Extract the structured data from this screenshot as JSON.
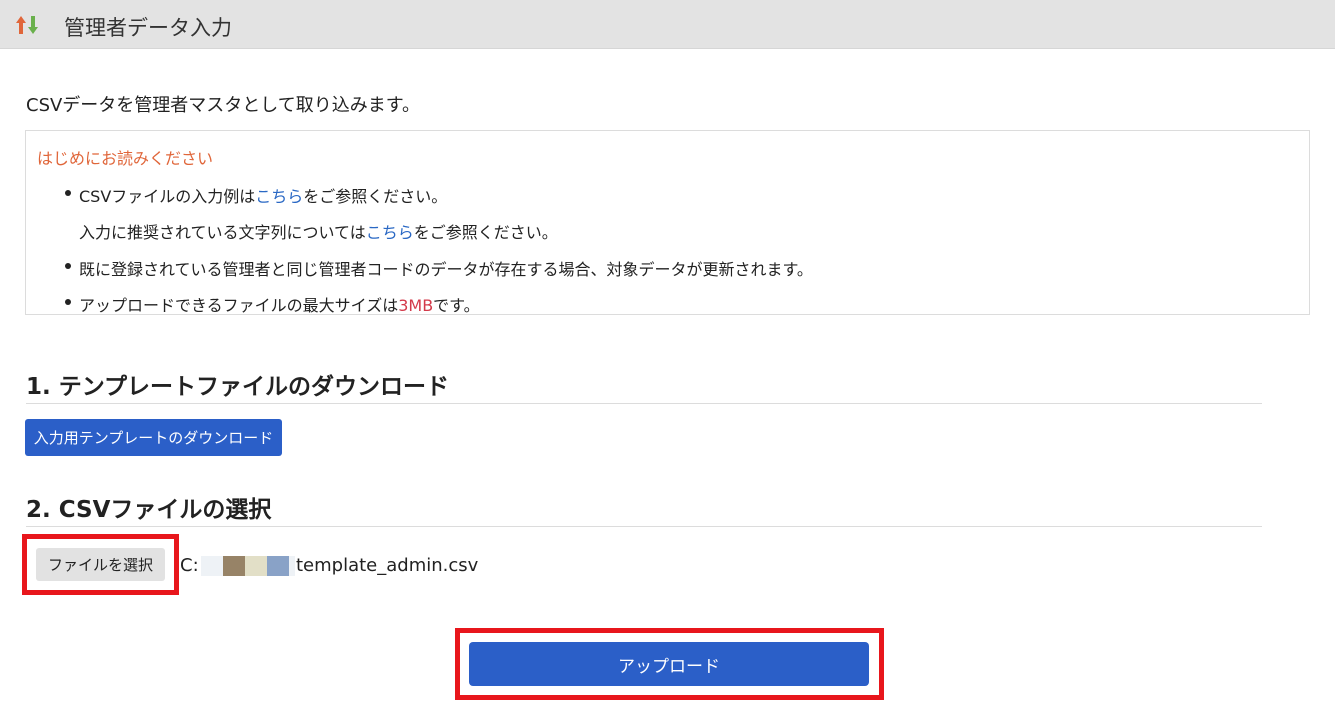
{
  "header": {
    "title": "管理者データ入力",
    "icon": "sort-arrows-icon"
  },
  "intro": "CSVデータを管理者マスタとして取り込みます。",
  "notice": {
    "title": "はじめにお読みください",
    "item1_pre": "CSVファイルの入力例は",
    "item1_link": "こちら",
    "item1_post": "をご参照ください。",
    "item1b_pre": "入力に推奨されている文字列については",
    "item1b_link": "こちら",
    "item1b_post": "をご参照ください。",
    "item2": "既に登録されている管理者と同じ管理者コードのデータが存在する場合、対象データが更新されます。",
    "item3_pre": "アップロードできるファイルの最大サイズは",
    "item3_size": "3MB",
    "item3_post": "です。"
  },
  "section1": {
    "title": "1. テンプレートファイルのダウンロード",
    "button": "入力用テンプレートのダウンロード"
  },
  "section2": {
    "title": "2. CSVファイルの選択",
    "file_button": "ファイルを選択",
    "path_prefix": "C:",
    "filename": "template_admin.csv"
  },
  "upload_button": "アップロード",
  "colors": {
    "primary": "#2b5fc8",
    "highlight": "#e8161c",
    "notice_title": "#e0663a",
    "link": "#2a68c4",
    "size_red": "#d33a4a",
    "header_bg": "#e3e3e3"
  }
}
